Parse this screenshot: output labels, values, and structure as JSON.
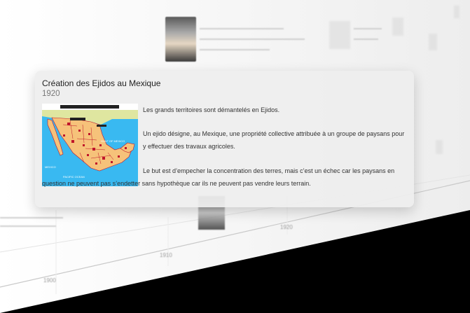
{
  "card": {
    "title": "Création des Ejidos au Mexique",
    "year": "1920",
    "paragraph_1": "Les grands territoires sont démantelés en Ejidos.",
    "paragraph_2": "Un ejido désigne, au Mexique, une propriété collective attribuée à un groupe de paysans pour y effectuer des travaux agricoles.",
    "paragraph_3": "Le but est d’empecher la concentration des terres, mais c’est un échec car les paysans en question ne peuvent pas s’endetter sans hypothèque car ils ne peuvent pas vendre leurs terrain."
  },
  "map": {
    "gulf_label": "GULF OF MEXICO",
    "ocean_label": "PACIFIC OCEAN",
    "country_label": "MEXICO",
    "colors": {
      "water": "#39b9f1",
      "land": "#f6c27a",
      "us": "#dfe6a0",
      "ejido": "#c0152a",
      "border": "#c0152a"
    }
  },
  "timeline": {
    "tick_labels": [
      "1900",
      "1910",
      "1920"
    ]
  }
}
